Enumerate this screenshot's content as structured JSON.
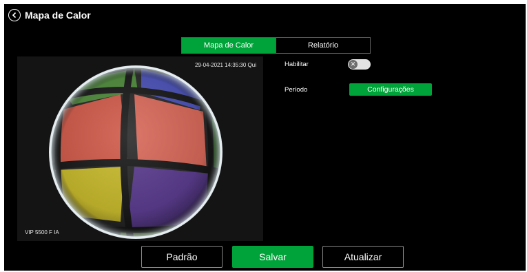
{
  "header": {
    "title": "Mapa de Calor"
  },
  "tabs": [
    {
      "label": "Mapa de Calor",
      "active": true
    },
    {
      "label": "Relatório",
      "active": false
    }
  ],
  "video": {
    "timestamp": "29-04-2021 14:35:30 Qui",
    "camera_name": "VIP 5500 F IA"
  },
  "form": {
    "enable_label": "Habilitar",
    "enable_value": false,
    "period_label": "Período",
    "config_button": "Configurações"
  },
  "footer": {
    "default_button": "Padrão",
    "save_button": "Salvar",
    "refresh_button": "Atualizar"
  },
  "colors": {
    "accent": "#00a33a",
    "background": "#000000"
  }
}
